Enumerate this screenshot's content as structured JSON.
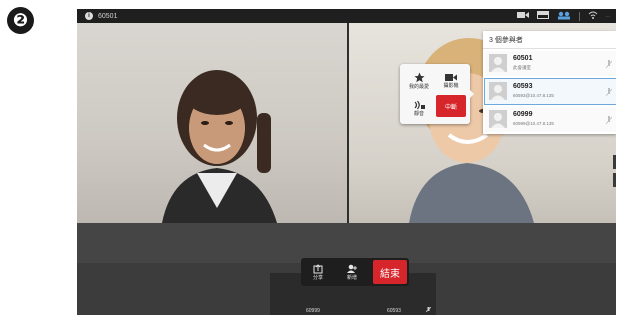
{
  "step_number": "❷",
  "topbar": {
    "call_id": "60501",
    "info_icon": "i",
    "icons": [
      "camera-icon",
      "layout-icon",
      "participants-icon",
      "signal-icon"
    ],
    "right_text": "..."
  },
  "popup": {
    "favorite_label": "我的最愛",
    "camera_label": "攝影機",
    "mute_label": "靜音",
    "drop_label": "中斷"
  },
  "participants": {
    "title": "3 個參與者",
    "items": [
      {
        "name": "60501",
        "sub": "此會議室",
        "selected": false
      },
      {
        "name": "60593",
        "sub": "60593@10.47.8.135",
        "selected": true
      },
      {
        "name": "60999",
        "sub": "60999@10.47.8.135",
        "selected": false
      }
    ]
  },
  "controls": {
    "share_label": "分享",
    "add_label": "新增",
    "end_label": "結束"
  },
  "selfview_labels": {
    "left": "60999",
    "right": "60593"
  },
  "colors": {
    "accent_red": "#d6252b",
    "selection_blue": "#6fa8dc"
  }
}
